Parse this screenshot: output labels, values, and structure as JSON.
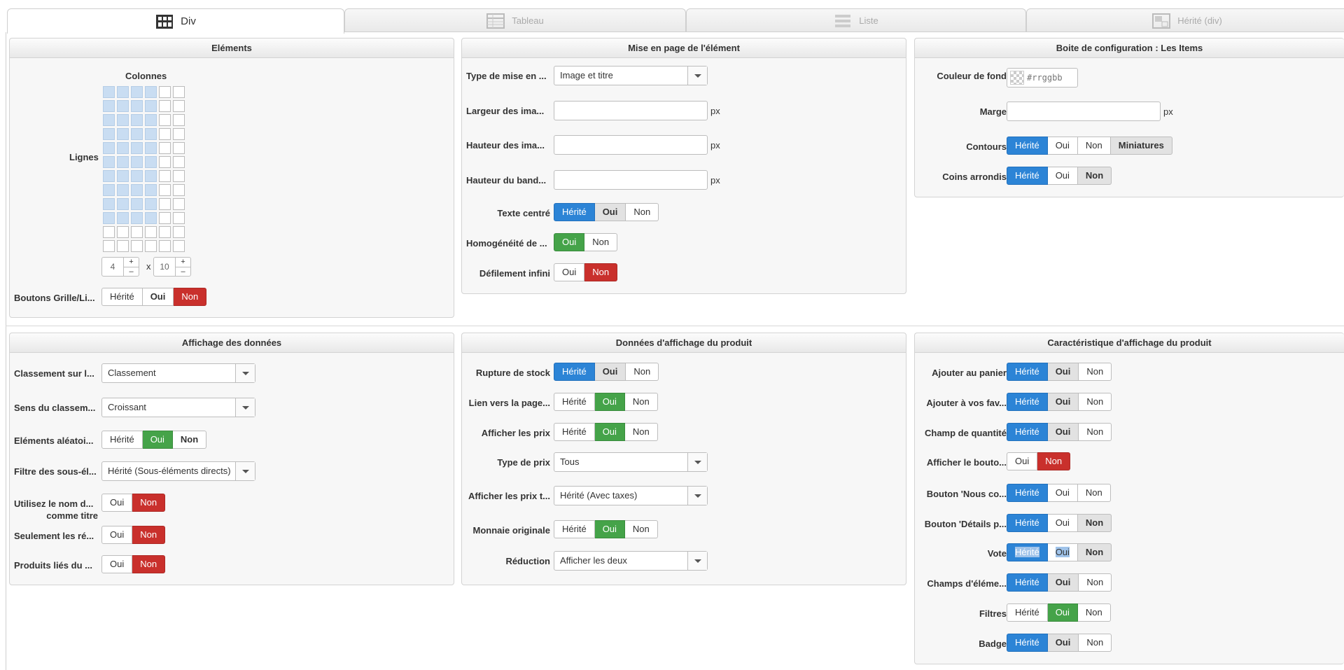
{
  "tabs": [
    {
      "label": "Div",
      "icon": "div-grid-icon"
    },
    {
      "label": "Tableau",
      "icon": "table-icon"
    },
    {
      "label": "Liste",
      "icon": "list-icon"
    },
    {
      "label": "Hérité (div)",
      "icon": "inherited-icon"
    }
  ],
  "elements": {
    "title": "Eléments",
    "colonnes_label": "Colonnes",
    "lignes_label": "Lignes",
    "cols_value": "4",
    "times": "x",
    "rows_value": "10",
    "plus": "+",
    "minus": "–",
    "grid_cols": 6,
    "grid_rows": 12,
    "boutons_label": "Boutons Grille/Li...",
    "boutons_options": [
      "Hérité",
      "Oui",
      "Non"
    ]
  },
  "miseenpage": {
    "title": "Mise en page de l'élément",
    "type_label": "Type de mise en ...",
    "type_value": "Image et titre",
    "largeur_label": "Largeur des ima...",
    "hauteur_label": "Hauteur des ima...",
    "bandeau_label": "Hauteur du band...",
    "unit": "px",
    "texte_label": "Texte centré",
    "texte_options": [
      "Hérité",
      "Oui",
      "Non"
    ],
    "homog_label": "Homogénéité de ...",
    "homog_options": [
      "Oui",
      "Non"
    ],
    "defil_label": "Défilement infini",
    "defil_options": [
      "Oui",
      "Non"
    ]
  },
  "boite": {
    "title": "Boite de configuration : Les Items",
    "couleur_label": "Couleur de fond",
    "couleur_placeholder": "#rrggbb",
    "marge_label": "Marge",
    "unit": "px",
    "contours_label": "Contours",
    "contours_options": [
      "Hérité",
      "Oui",
      "Non",
      "Miniatures"
    ],
    "coins_label": "Coins arrondis",
    "coins_options": [
      "Hérité",
      "Oui",
      "Non"
    ]
  },
  "affichage": {
    "title": "Affichage des données",
    "classement_label": "Classement sur l...",
    "classement_value": "Classement",
    "sens_label": "Sens du classem...",
    "sens_value": "Croissant",
    "aleatoire_label": "Eléments aléatoi...",
    "aleatoire_options": [
      "Hérité",
      "Oui",
      "Non"
    ],
    "filtre_label": "Filtre des sous-él...",
    "filtre_value": "Hérité (Sous-éléments directs)",
    "utilisez_label_1": "Utilisez le nom d...",
    "utilisez_label_2": "comme titre",
    "utilisez_options": [
      "Oui",
      "Non"
    ],
    "seulement_label": "Seulement les ré...",
    "seulement_options": [
      "Oui",
      "Non"
    ],
    "produits_label": "Produits liés du ...",
    "produits_options": [
      "Oui",
      "Non"
    ]
  },
  "donnees": {
    "title": "Données d'affichage du produit",
    "rupture_label": "Rupture de stock",
    "rupture_options": [
      "Hérité",
      "Oui",
      "Non"
    ],
    "lien_label": "Lien vers la page...",
    "lien_options": [
      "Hérité",
      "Oui",
      "Non"
    ],
    "prix_label": "Afficher les prix",
    "prix_options": [
      "Hérité",
      "Oui",
      "Non"
    ],
    "type_prix_label": "Type de prix",
    "type_prix_value": "Tous",
    "prix_t_label": "Afficher les prix t...",
    "prix_t_value": "Hérité (Avec taxes)",
    "monnaie_label": "Monnaie originale",
    "monnaie_options": [
      "Hérité",
      "Oui",
      "Non"
    ],
    "reduction_label": "Réduction",
    "reduction_value": "Afficher les deux"
  },
  "caract": {
    "title": "Caractéristique d'affichage du produit",
    "rows": [
      {
        "label": "Ajouter au panier",
        "options": [
          "Hérité",
          "Oui",
          "Non"
        ]
      },
      {
        "label": "Ajouter à vos fav...",
        "options": [
          "Hérité",
          "Oui",
          "Non"
        ]
      },
      {
        "label": "Champ de quantité",
        "options": [
          "Hérité",
          "Oui",
          "Non"
        ]
      },
      {
        "label": "Afficher le bouto...",
        "options": [
          "Oui",
          "Non"
        ]
      },
      {
        "label": "Bouton 'Nous co...",
        "options": [
          "Hérité",
          "Oui",
          "Non"
        ]
      },
      {
        "label": "Bouton 'Détails p...",
        "options": [
          "Hérité",
          "Oui",
          "Non"
        ]
      },
      {
        "label": "Vote",
        "options": [
          "Hérité",
          "Oui",
          "Non"
        ]
      },
      {
        "label": "Champs d'éléme...",
        "options": [
          "Hérité",
          "Oui",
          "Non"
        ]
      },
      {
        "label": "Filtres",
        "options": [
          "Hérité",
          "Oui",
          "Non"
        ]
      },
      {
        "label": "Badge",
        "options": [
          "Hérité",
          "Oui",
          "Non"
        ]
      }
    ]
  }
}
